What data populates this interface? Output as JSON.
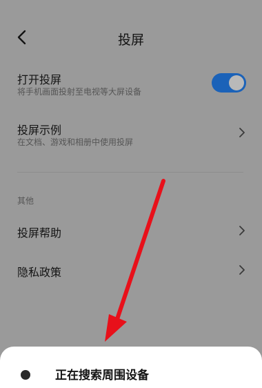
{
  "header": {
    "back_icon": "chevron-left-icon",
    "title": "投屏"
  },
  "settings": {
    "open_cast": {
      "label": "打开投屏",
      "subtitle": "将手机画面投射至电视等大屏设备",
      "enabled": true,
      "toggle_color": "#1b62b8"
    },
    "cast_demo": {
      "label": "投屏示例",
      "subtitle": "在文档、游戏和相册中使用投屏",
      "icon": "chevron-right-icon"
    }
  },
  "other": {
    "section_label": "其他",
    "items": [
      {
        "label": "投屏帮助",
        "icon": "chevron-right-icon"
      },
      {
        "label": "隐私政策",
        "icon": "chevron-right-icon"
      }
    ]
  },
  "annotation": {
    "arrow_color": "#e8101a"
  },
  "bottom_sheet": {
    "title": "正在搜索周围设备"
  }
}
